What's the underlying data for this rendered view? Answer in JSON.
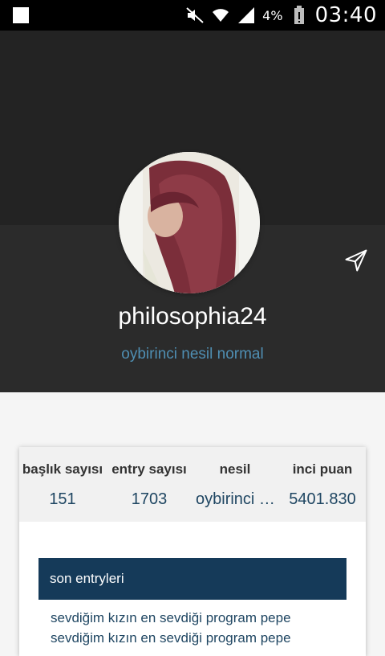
{
  "status_bar": {
    "battery_pct": "4%",
    "time": "03:40",
    "icons": [
      "mute-icon",
      "wifi-icon",
      "signal-icon",
      "battery-icon"
    ]
  },
  "profile": {
    "username": "philosophia24",
    "subtitle": "oybirinci nesil normal"
  },
  "stats": [
    {
      "label": "başlık sayısı",
      "value": "151"
    },
    {
      "label": "entry sayısı",
      "value": "1703"
    },
    {
      "label": "nesil",
      "value": "oybirinci nesil normal"
    },
    {
      "label": "inci puan",
      "value": "5401.830"
    }
  ],
  "section": {
    "title": "son entryleri"
  },
  "entries": [
    {
      "text": "sevdiğim kızın en sevdiği program pepe"
    },
    {
      "text": "sevdiğim kızın en sevdiği program pepe"
    }
  ],
  "colors": {
    "header_top": "#232323",
    "header_bottom": "#2b2b2b",
    "accent_blue": "#4f8fb3",
    "section_bar": "#153a59"
  }
}
